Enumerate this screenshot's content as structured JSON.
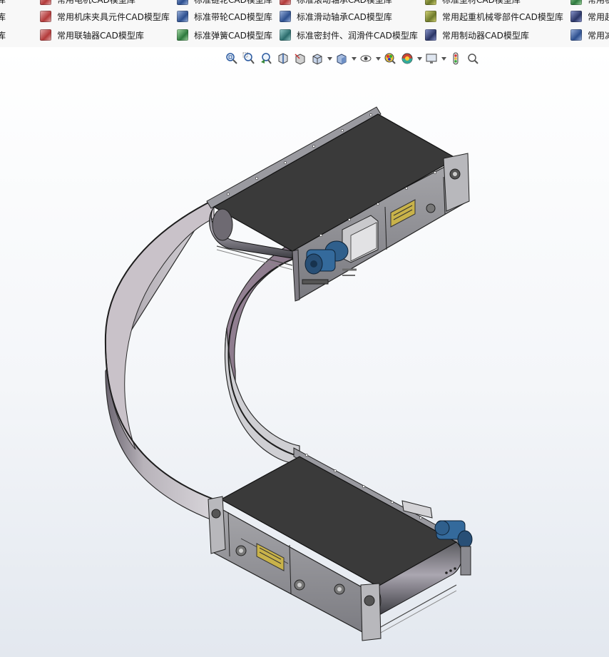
{
  "library": {
    "row0": [
      {
        "label": "模型库",
        "icon": "library-icon-red"
      },
      {
        "label": "常用电机CAD模型库",
        "icon": "library-icon-red"
      },
      {
        "label": "标准链轮CAD模型库",
        "icon": "library-icon-blue"
      },
      {
        "label": "标准滚动轴承CAD模型库",
        "icon": "library-icon-red"
      },
      {
        "label": "标准型材CAD模型库",
        "icon": "library-icon-olive"
      },
      {
        "label": "常用机",
        "icon": "library-icon-green"
      }
    ],
    "row1": [
      {
        "label": "模型库",
        "icon": "library-icon-red"
      },
      {
        "label": "常用机床夹具元件CAD模型库",
        "icon": "library-icon-red"
      },
      {
        "label": "标准带轮CAD模型库",
        "icon": "library-icon-blue"
      },
      {
        "label": "标准滑动轴承CAD模型库",
        "icon": "library-icon-blue"
      },
      {
        "label": "常用起重机械零部件CAD模型库",
        "icon": "library-icon-olive"
      },
      {
        "label": "常用起",
        "icon": "library-icon-navy"
      }
    ],
    "row2": [
      {
        "label": "模型库",
        "icon": "library-icon-red"
      },
      {
        "label": "常用联轴器CAD模型库",
        "icon": "library-icon-red"
      },
      {
        "label": "标准弹簧CAD模型库",
        "icon": "library-icon-green"
      },
      {
        "label": "标准密封件、润滑件CAD模型库",
        "icon": "library-icon-teal"
      },
      {
        "label": "常用制动器CAD模型库",
        "icon": "library-icon-navy"
      },
      {
        "label": "常用减",
        "icon": "library-icon-blue"
      }
    ]
  },
  "heads_up_toolbar": [
    {
      "icon": "zoom-to-fit-icon",
      "caret": false
    },
    {
      "icon": "zoom-to-area-icon",
      "caret": false
    },
    {
      "icon": "previous-view-icon",
      "caret": false
    },
    {
      "icon": "section-view-icon",
      "caret": false
    },
    {
      "icon": "dynamic-annotation-icon",
      "caret": false
    },
    {
      "icon": "view-orientation-icon",
      "caret": true
    },
    {
      "icon": "display-style-icon",
      "caret": true
    },
    {
      "icon": "hide-show-items-icon",
      "caret": true
    },
    {
      "icon": "edit-appearance-icon",
      "caret": false
    },
    {
      "icon": "apply-scene-icon",
      "caret": true
    },
    {
      "icon": "view-settings-icon",
      "caret": true
    },
    {
      "icon": "realview-icon",
      "caret": false
    },
    {
      "icon": "zoom-search-icon",
      "caret": false
    }
  ],
  "colors": {
    "belt": "#3a3a3a",
    "frame": "#8e8e92",
    "curve_inner": "#8a7289",
    "motor": "#2f5f8c",
    "label_plate": "#c8b24a"
  }
}
